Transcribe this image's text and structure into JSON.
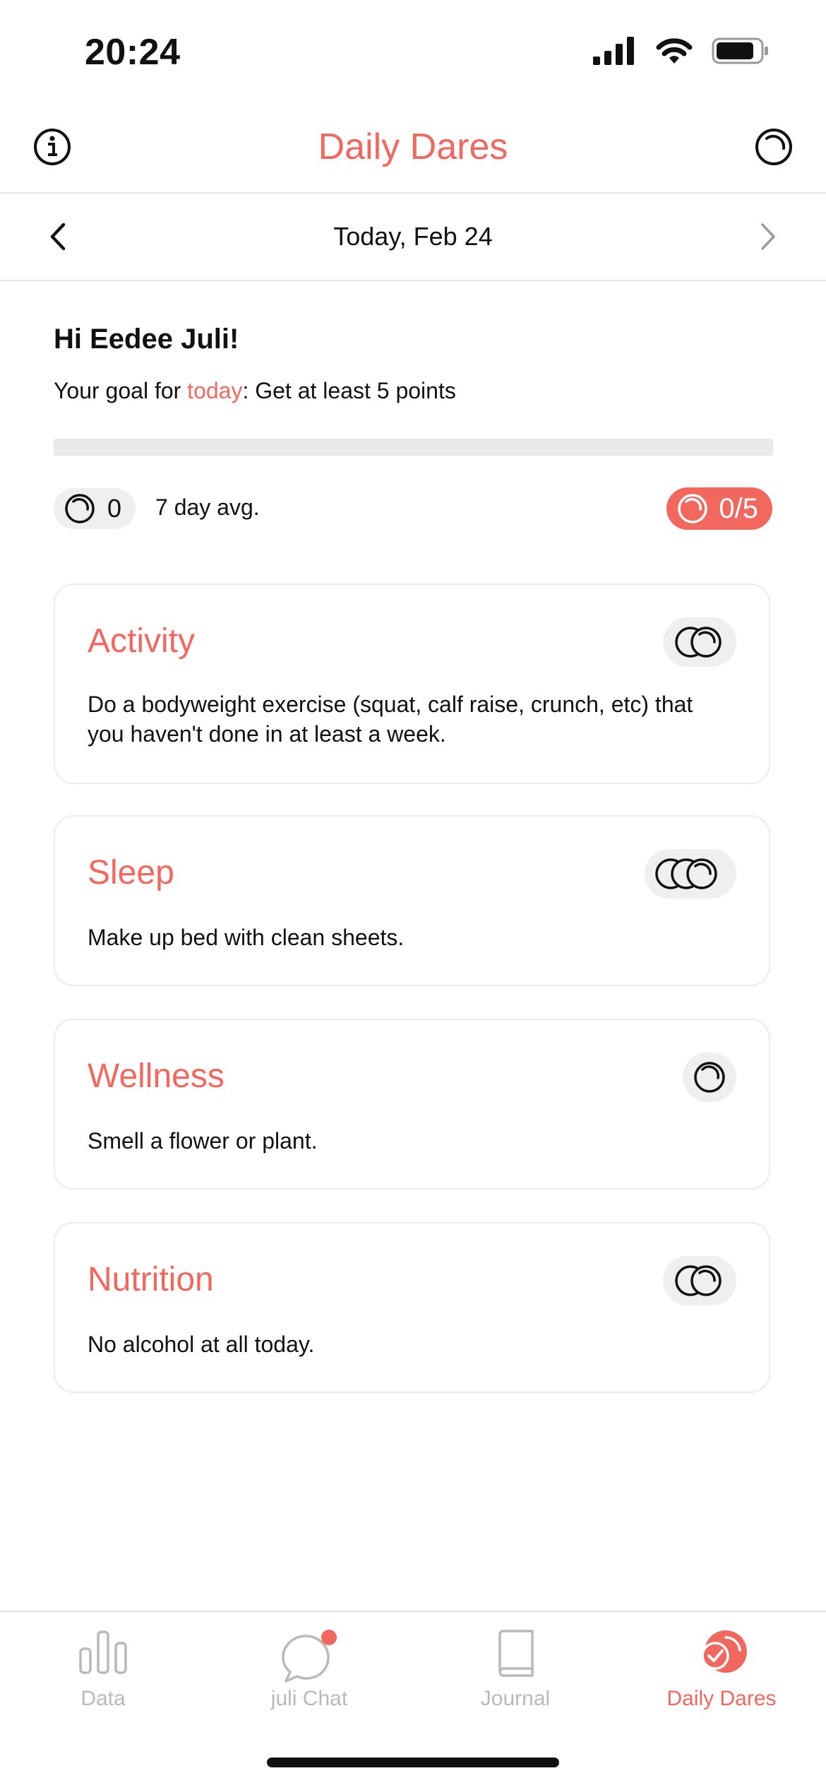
{
  "status_bar": {
    "time": "20:24"
  },
  "nav": {
    "title": "Daily Dares"
  },
  "date_nav": {
    "label": "Today, Feb 24"
  },
  "greeting": {
    "hello": "Hi Eedee Juli!",
    "goal_prefix": "Your goal for ",
    "goal_accent": "today",
    "goal_suffix": ": Get at least 5 points"
  },
  "progress": {
    "value": 0,
    "max": 5
  },
  "stats": {
    "avg_value": "0",
    "avg_label": "7 day avg.",
    "score": "0/5"
  },
  "cards": [
    {
      "title": "Activity",
      "text": "Do a bodyweight exercise (squat, calf raise, crunch, etc) that you haven't done in at least a week.",
      "coins": 2
    },
    {
      "title": "Sleep",
      "text": "Make up bed with clean sheets.",
      "coins": 3
    },
    {
      "title": "Wellness",
      "text": "Smell a flower or plant.",
      "coins": 1
    },
    {
      "title": "Nutrition",
      "text": "No alcohol at all today.",
      "coins": 2
    }
  ],
  "tabs": [
    {
      "label": "Data",
      "icon": "bar-chart-icon"
    },
    {
      "label": "juli Chat",
      "icon": "chat-bubble-icon"
    },
    {
      "label": "Journal",
      "icon": "book-icon"
    },
    {
      "label": "Daily Dares",
      "icon": "daily-dares-icon"
    }
  ],
  "colors": {
    "accent": "#f2675e",
    "inactive": "#b9b9b9",
    "pill_bg": "#efefef"
  }
}
